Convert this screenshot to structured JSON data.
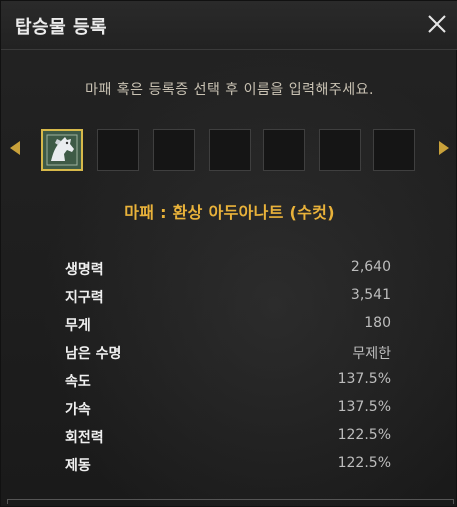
{
  "window": {
    "title": "탑승물 등록",
    "instruction": "마패 혹은 등록증 선택 후 이름을 입력해주세요."
  },
  "slots": {
    "count": 7,
    "selected_index": 0,
    "selected_icon": "horse-token-icon"
  },
  "mount": {
    "name": "마패 : 환상 아두아나트 (수컷)"
  },
  "stats": [
    {
      "label": "생명력",
      "value": "2,640"
    },
    {
      "label": "지구력",
      "value": "3,541"
    },
    {
      "label": "무게",
      "value": "180"
    },
    {
      "label": "남은 수명",
      "value": "무제한"
    },
    {
      "label": "속도",
      "value": "137.5%"
    },
    {
      "label": "가속",
      "value": "137.5%"
    },
    {
      "label": "회전력",
      "value": "122.5%"
    },
    {
      "label": "제동",
      "value": "122.5%"
    }
  ],
  "colors": {
    "accent_gold": "#e9b23a",
    "slot_border_selected": "#d7b94a"
  }
}
